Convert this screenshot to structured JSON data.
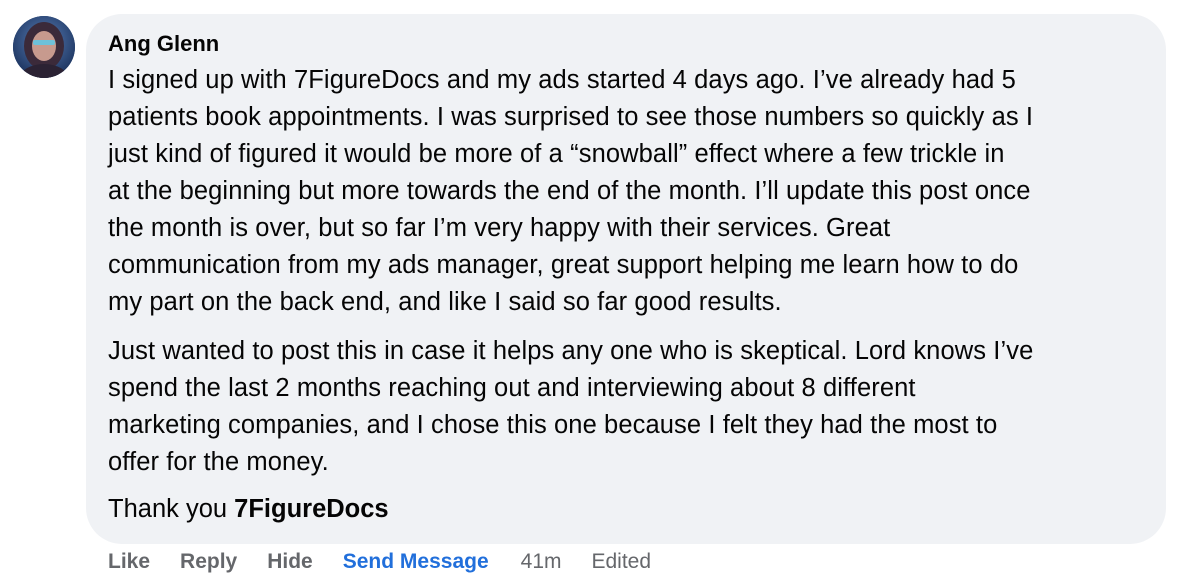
{
  "comment": {
    "author": "Ang Glenn",
    "paragraph1": [
      "I signed up with 7FigureDocs and my ads started 4 days ago. I’ve already had 5",
      "patients book appointments. I was surprised to see those numbers so quickly as I",
      "just kind of figured it would be more of a “snowball” effect where a few trickle in",
      "at the beginning but more towards the end of the month. I’ll update this post once",
      "the month is over, but so far I’m very happy with their services. Great",
      "communication from my ads manager, great support helping me learn how to do",
      "my part on the back end, and like I said so far good results."
    ],
    "paragraph2": [
      "Just wanted to post this in case it helps any one who is skeptical. Lord knows I’ve",
      "spend the last 2 months reaching out and interviewing about 8 different",
      "marketing companies, and I chose this one because I felt they had the most to",
      "offer for the money."
    ],
    "thanks_prefix": "Thank you ",
    "thanks_bold": "7FigureDocs"
  },
  "actions": {
    "like": "Like",
    "reply": "Reply",
    "hide": "Hide",
    "send_message": "Send Message",
    "time": "41m",
    "edited": "Edited"
  },
  "colors": {
    "bubble": "#f0f2f5",
    "link_blue": "#216fdb",
    "muted": "#65676b"
  },
  "icons": {
    "avatar": "user-avatar"
  }
}
